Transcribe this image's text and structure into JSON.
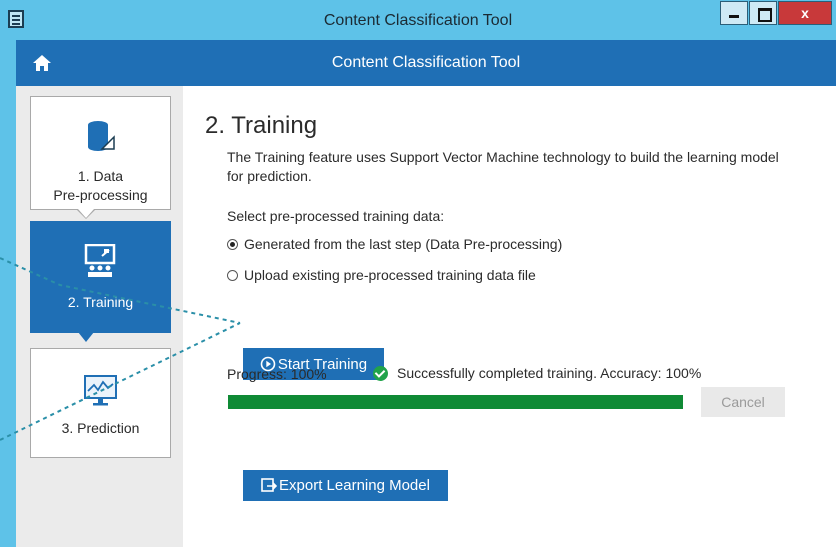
{
  "window": {
    "title": "Content Classification Tool",
    "close_label": "x"
  },
  "header": {
    "title": "Content Classification Tool"
  },
  "sidebar": {
    "steps": [
      {
        "line1": "1. Data",
        "line2": "Pre-processing",
        "icon": "database-icon",
        "active": false
      },
      {
        "line1": "2. Training",
        "line2": "",
        "icon": "presentation-icon",
        "active": true
      },
      {
        "line1": "3. Prediction",
        "line2": "",
        "icon": "monitor-chart-icon",
        "active": false
      }
    ]
  },
  "main": {
    "heading": "2. Training",
    "description": "The Training feature uses Support Vector Machine technology to build the learning model for prediction.",
    "select_label": "Select pre-processed training data:",
    "options": [
      {
        "label": "Generated from the last step (Data Pre-processing)",
        "selected": true
      },
      {
        "label": "Upload existing pre-processed training data file",
        "selected": false
      }
    ],
    "start_button": "Start Training",
    "progress_label": "Progress: 100%",
    "progress_value": 1.0,
    "status_text": "Successfully completed training. Accuracy: 100%",
    "cancel_button": "Cancel",
    "export_button": "Export Learning Model"
  },
  "colors": {
    "accent": "#1f6fb5",
    "titlebar": "#5ec2e8",
    "progress": "#0f8a35",
    "success": "#21a34a",
    "close": "#c8393a"
  }
}
